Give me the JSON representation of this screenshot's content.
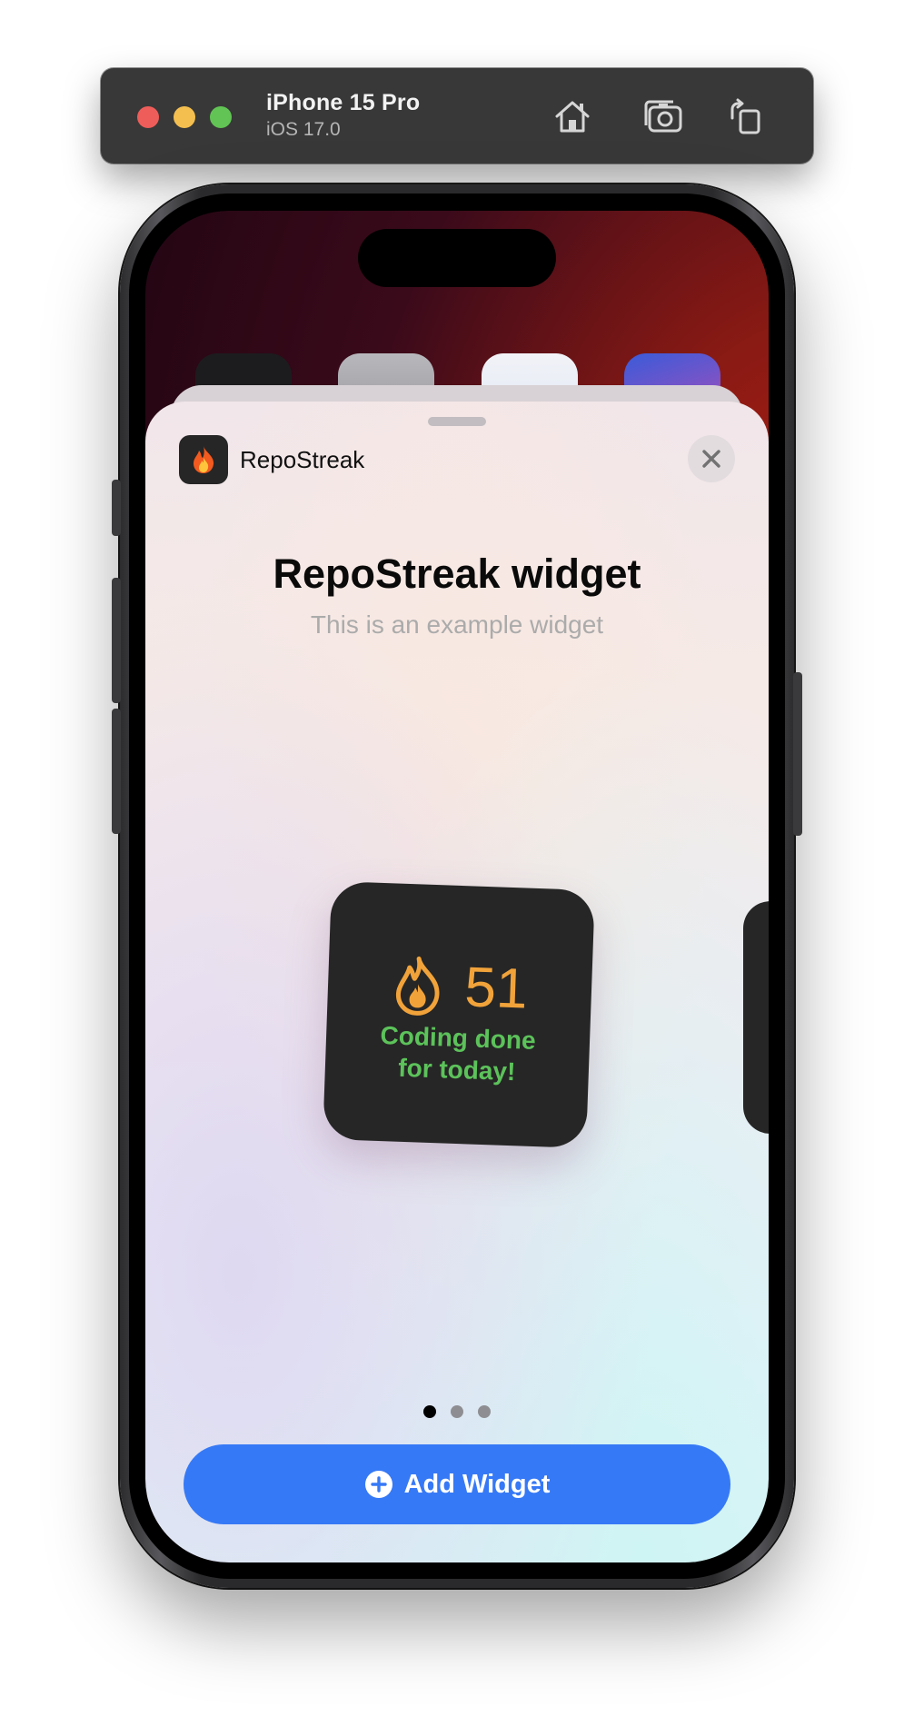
{
  "simulator": {
    "device_name": "iPhone 15 Pro",
    "os_version": "iOS 17.0",
    "buttons": [
      "home-icon",
      "screenshot-icon",
      "rotate-icon"
    ]
  },
  "sheet": {
    "app_name": "RepoStreak",
    "app_icon": "flame-emoji",
    "title": "RepoStreak widget",
    "description": "This is an example widget",
    "widget": {
      "icon": "flame-icon",
      "streak_count": "51",
      "message_line1": "Coding done",
      "message_line2": "for today!"
    },
    "page_dots": {
      "count": 3,
      "active_index": 0
    },
    "add_button_label": "Add Widget"
  },
  "colors": {
    "accent_blue": "#3679f6",
    "streak_orange": "#f1a33a",
    "success_green": "#5cc25a"
  }
}
